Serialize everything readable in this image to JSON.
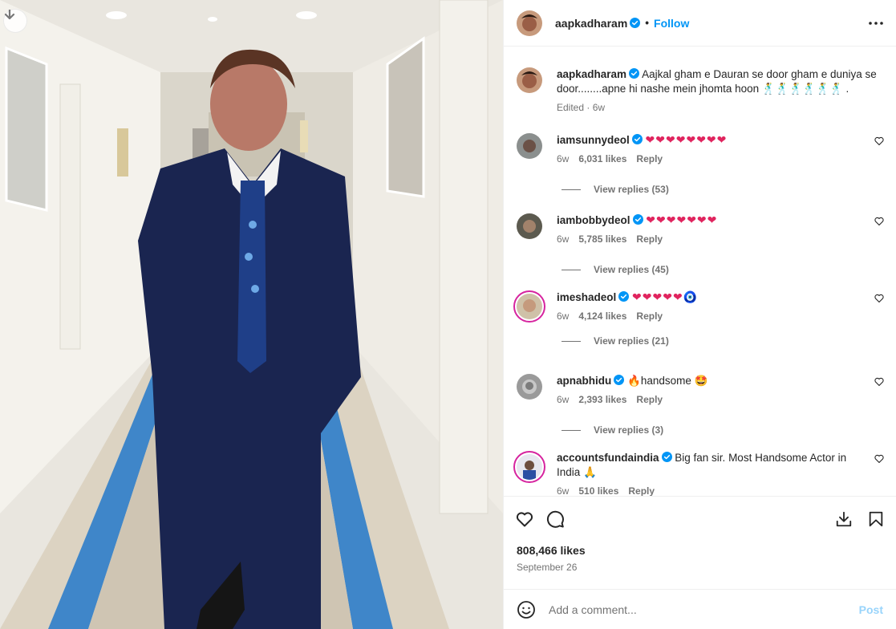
{
  "post": {
    "username": "aapkadharam",
    "follow_label": "Follow",
    "caption": "Aajkal gham e Dauran se door gham e duniya se door........apne hi nashe mein jhomta hoon 🕺🕺🕺🕺🕺🕺 .",
    "caption_meta": "Edited · 6w"
  },
  "comments": [
    {
      "username": "iamsunnydeol",
      "text": "❤❤❤❤❤❤❤❤",
      "age": "6w",
      "likes": "6,031 likes",
      "reply": "Reply",
      "view_replies": "View replies (53)"
    },
    {
      "username": "iambobbydeol",
      "text": "❤❤❤❤❤❤❤",
      "age": "6w",
      "likes": "5,785 likes",
      "reply": "Reply",
      "view_replies": "View replies (45)"
    },
    {
      "username": "imeshadeol",
      "text": "❤❤❤❤❤🧿",
      "age": "6w",
      "likes": "4,124 likes",
      "reply": "Reply",
      "view_replies": "View replies (21)"
    },
    {
      "username": "apnabhidu",
      "text": "🔥handsome 🤩",
      "age": "6w",
      "likes": "2,393 likes",
      "reply": "Reply",
      "view_replies": "View replies (3)"
    },
    {
      "username": "accountsfundaindia",
      "text": "Big fan sir. Most Handsome Actor in India 🙏",
      "age": "6w",
      "likes": "510 likes",
      "reply": "Reply"
    }
  ],
  "stats": {
    "likes": "808,466 likes",
    "date": "September 26"
  },
  "composer": {
    "placeholder": "Add a comment...",
    "post_label": "Post"
  },
  "colors": {
    "accent": "#0095f6",
    "verified": "#0095f6",
    "heart": "#e0245e"
  },
  "icons": [
    "download-icon",
    "verified-icon",
    "more-icon",
    "heart-icon",
    "comment-icon",
    "save-icon",
    "bookmark-icon",
    "emoji-icon"
  ]
}
